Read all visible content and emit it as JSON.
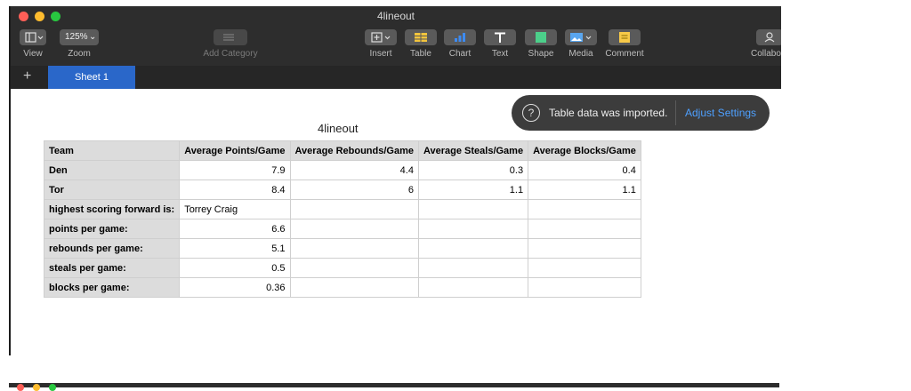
{
  "window": {
    "title": "4lineout"
  },
  "toolbar": {
    "view": "View",
    "zoom_value": "125%",
    "zoom": "Zoom",
    "add_category": "Add Category",
    "insert": "Insert",
    "table": "Table",
    "chart": "Chart",
    "text": "Text",
    "shape": "Shape",
    "media": "Media",
    "comment": "Comment",
    "collaborate": "Collabo"
  },
  "tabs": {
    "add": "+",
    "sheet1": "Sheet 1"
  },
  "sheet": {
    "title": "4lineout"
  },
  "toast": {
    "message": "Table data was imported.",
    "action": "Adjust Settings"
  },
  "table": {
    "headers": [
      "Team",
      "Average Points/Game",
      "Average Rebounds/Game",
      "Average Steals/Game",
      "Average Blocks/Game"
    ],
    "rows": [
      [
        "Den",
        "7.9",
        "4.4",
        "0.3",
        "0.4"
      ],
      [
        "Tor",
        "8.4",
        "6",
        "1.1",
        "1.1"
      ],
      [
        "highest scoring forward is:",
        "Torrey Craig",
        "",
        "",
        ""
      ],
      [
        "points per game:",
        "6.6",
        "",
        "",
        ""
      ],
      [
        "rebounds per game:",
        "5.1",
        "",
        "",
        ""
      ],
      [
        "steals per game:",
        "0.5",
        "",
        "",
        ""
      ],
      [
        "blocks per game:",
        "0.36",
        "",
        "",
        ""
      ]
    ]
  }
}
